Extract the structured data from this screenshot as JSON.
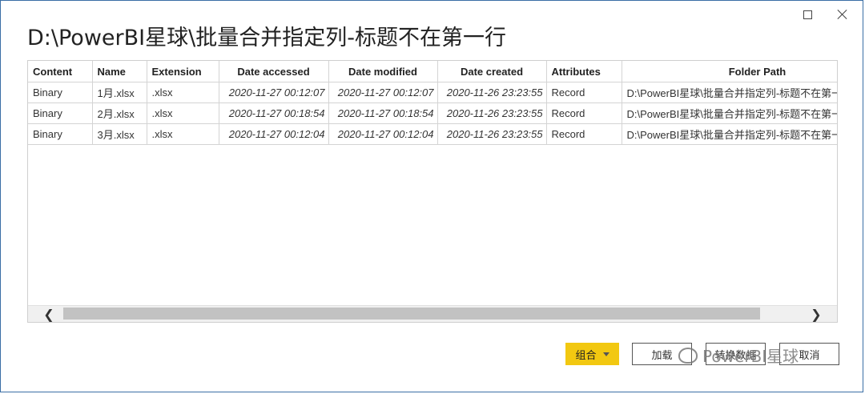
{
  "window": {
    "title": "D:\\PowerBI星球\\批量合并指定列-标题不在第一行"
  },
  "icons": {
    "maximize": "maximize-icon",
    "close": "close-icon",
    "scroll_left": "chevron-left-icon",
    "scroll_right": "chevron-right-icon",
    "combine_caret": "caret-down-icon",
    "watermark": "wechat-logo-icon"
  },
  "table": {
    "columns": [
      "Content",
      "Name",
      "Extension",
      "Date accessed",
      "Date modified",
      "Date created",
      "Attributes",
      "Folder Path"
    ],
    "rows": [
      [
        "Binary",
        "1月.xlsx",
        ".xlsx",
        "2020-11-27 00:12:07",
        "2020-11-27 00:12:07",
        "2020-11-26 23:23:55",
        "Record",
        "D:\\PowerBI星球\\批量合并指定列-标题不在第一行\\"
      ],
      [
        "Binary",
        "2月.xlsx",
        ".xlsx",
        "2020-11-27 00:18:54",
        "2020-11-27 00:18:54",
        "2020-11-26 23:23:55",
        "Record",
        "D:\\PowerBI星球\\批量合并指定列-标题不在第一行\\"
      ],
      [
        "Binary",
        "3月.xlsx",
        ".xlsx",
        "2020-11-27 00:12:04",
        "2020-11-27 00:12:04",
        "2020-11-26 23:23:55",
        "Record",
        "D:\\PowerBI星球\\批量合并指定列-标题不在第一行\\"
      ]
    ]
  },
  "scrollbar": {
    "left_glyph": "❮",
    "right_glyph": "❯"
  },
  "buttons": {
    "combine": "组合",
    "load": "加载",
    "transform": "转换数据",
    "cancel": "取消"
  },
  "watermark": {
    "text": "PowerBI星球"
  },
  "colors": {
    "accent": "#F2C811",
    "window_border": "#3A6EA5"
  }
}
